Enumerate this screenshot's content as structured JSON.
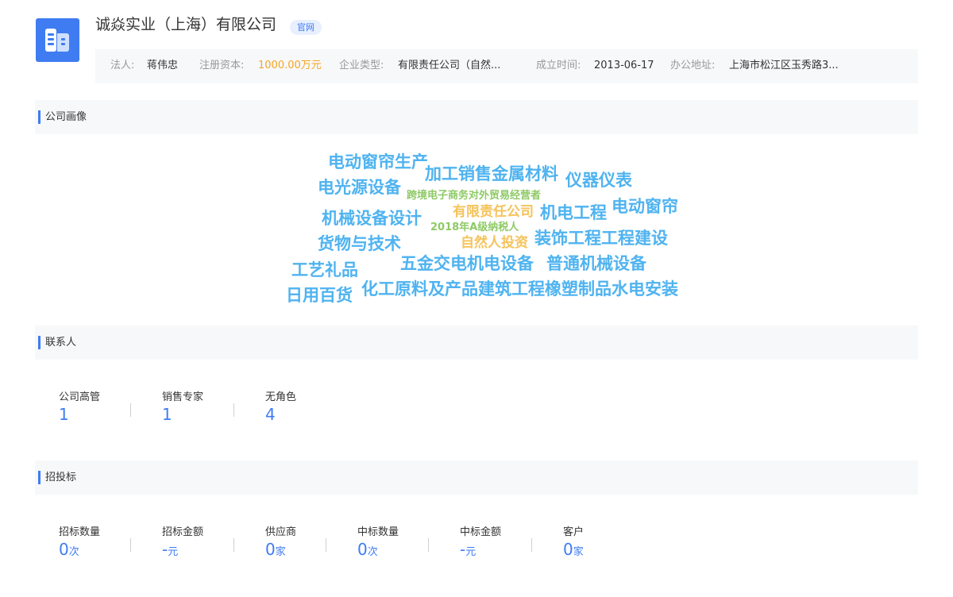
{
  "company": {
    "name": "诚焱实业（上海）有限公司",
    "website_tag": "官网",
    "info": {
      "legal_person_label": "法人:",
      "legal_person": "蒋伟忠",
      "capital_label": "注册资本:",
      "capital": "1000.00万元",
      "type_label": "企业类型:",
      "type": "有限责任公司（自然...",
      "founded_label": "成立时间:",
      "founded": "2013-06-17",
      "address_label": "办公地址:",
      "address": "上海市松江区玉秀路3..."
    }
  },
  "colors": {
    "accent": "#3f7cf2",
    "cloud_blue": "#4fb3f0",
    "cloud_green": "#8fca66",
    "cloud_orange": "#f5c35a"
  },
  "portrait": {
    "title": "公司画像",
    "words": [
      "电动窗帘生产",
      "加工销售金属材料",
      "仪器仪表",
      "电光源设备",
      "跨境电子商务对外贸易经营者",
      "机械设备设计",
      "有限责任公司",
      "机电工程",
      "电动窗帘",
      "2018年A级纳税人",
      "货物与技术",
      "自然人投资",
      "装饰工程工程建设",
      "工艺礼品",
      "五金交电机电设备",
      "普通机械设备",
      "日用百货",
      "化工原料及产品建筑工程橡塑制品水电安装"
    ]
  },
  "contacts": {
    "title": "联系人",
    "stats": [
      {
        "label": "公司高管",
        "value": "1"
      },
      {
        "label": "销售专家",
        "value": "1"
      },
      {
        "label": "无角色",
        "value": "4"
      }
    ]
  },
  "bidding": {
    "title": "招投标",
    "stats": [
      {
        "label": "招标数量",
        "value": "0",
        "unit": "次"
      },
      {
        "label": "招标金额",
        "value": "-",
        "unit": "元"
      },
      {
        "label": "供应商",
        "value": "0",
        "unit": "家"
      },
      {
        "label": "中标数量",
        "value": "0",
        "unit": "次"
      },
      {
        "label": "中标金额",
        "value": "-",
        "unit": "元"
      },
      {
        "label": "客户",
        "value": "0",
        "unit": "家"
      }
    ]
  }
}
